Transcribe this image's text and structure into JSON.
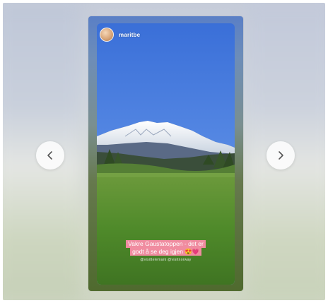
{
  "story": {
    "username": "maritbe",
    "caption_line1": "Vakre Gaustatoppen - det er",
    "caption_line2": "godt å se deg igjen",
    "caption_emoji": "😍",
    "caption_heart": "💗",
    "tags": "@visittelemark @visitnorway"
  },
  "icons": {
    "prev": "chevron-left-icon",
    "next": "chevron-right-icon"
  },
  "colors": {
    "caption_bg": "#f08ca0",
    "sky_top": "#3f73d6",
    "grass": "#4f8a2a"
  }
}
